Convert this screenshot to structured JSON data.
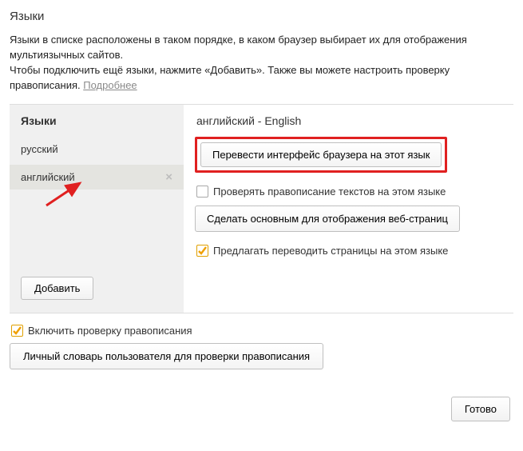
{
  "title": "Языки",
  "intro": {
    "line1": "Языки в списке расположены в таком порядке, в каком браузер выбирает их для отображения мультиязычных сайтов.",
    "line2a": "Чтобы подключить ещё языки, нажмите «Добавить». Также вы можете настроить проверку правописания. ",
    "learn_more": "Подробнее"
  },
  "sidebar": {
    "header": "Языки",
    "items": [
      {
        "label": "русский",
        "selected": false,
        "removable": false
      },
      {
        "label": "английский",
        "selected": true,
        "removable": true
      }
    ],
    "add_label": "Добавить"
  },
  "detail": {
    "heading": "английский - English",
    "translate_ui_btn": "Перевести интерфейс браузера на этот язык",
    "spellcheck_label": "Проверять правописание текстов на этом языке",
    "spellcheck_checked": false,
    "make_default_btn": "Сделать основным для отображения веб-страниц",
    "offer_translate_label": "Предлагать переводить страницы на этом языке",
    "offer_translate_checked": true
  },
  "below": {
    "enable_spellcheck_label": "Включить проверку правописания",
    "enable_spellcheck_checked": true,
    "dictionary_btn": "Личный словарь пользователя для проверки правописания"
  },
  "footer": {
    "done": "Готово"
  },
  "colors": {
    "highlight": "#e02020",
    "check_orange": "#f0a000"
  }
}
